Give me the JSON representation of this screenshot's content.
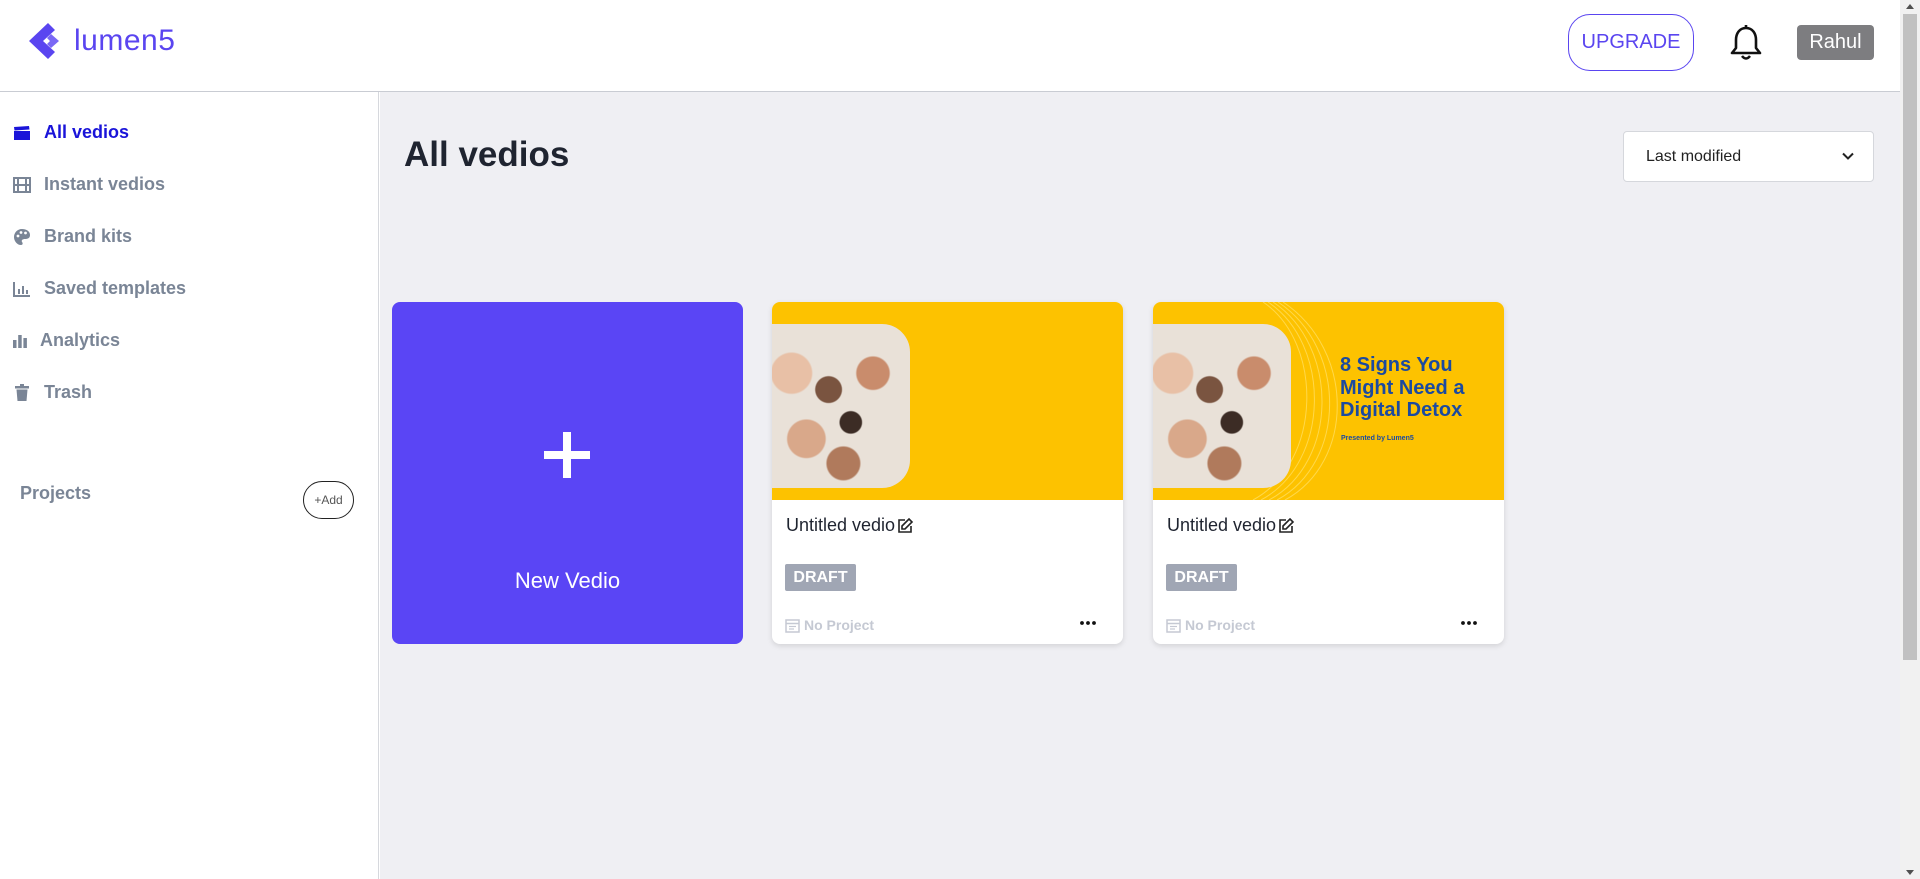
{
  "app": {
    "logo_text": "lumen5",
    "brand_color": "#5a45f0"
  },
  "header": {
    "upgrade_label": "UPGRADE",
    "user_name": "Rahul"
  },
  "sidebar": {
    "items": [
      {
        "label": "All vedios",
        "icon": "clapperboard-icon",
        "active": true
      },
      {
        "label": "Instant vedios",
        "icon": "film-icon",
        "active": false
      },
      {
        "label": "Brand kits",
        "icon": "palette-icon",
        "active": false
      },
      {
        "label": "Saved templates",
        "icon": "chart-icon",
        "active": false
      },
      {
        "label": "Analytics",
        "icon": "bar-chart-icon",
        "active": false
      },
      {
        "label": "Trash",
        "icon": "trash-icon",
        "active": false
      }
    ],
    "projects_label": "Projects",
    "add_label": "+Add"
  },
  "main": {
    "title": "All vedios",
    "sort_value": "Last modified",
    "new_card_label": "New Vedio",
    "videos": [
      {
        "title": "Untitled vedio",
        "status": "DRAFT",
        "project": "No Project",
        "thumb_title": "",
        "thumb_subtitle": ""
      },
      {
        "title": "Untitled vedio",
        "status": "DRAFT",
        "project": "No Project",
        "thumb_title": "8 Signs You Might Need a Digital Detox",
        "thumb_subtitle": "Presented by Lumen5"
      }
    ]
  }
}
